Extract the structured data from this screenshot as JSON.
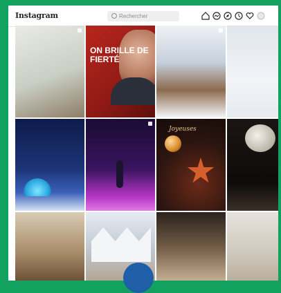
{
  "header": {
    "logo_text": "Instagram",
    "search_placeholder": "Rechercher",
    "icons": [
      "home-icon",
      "messages-icon",
      "explore-icon",
      "activity-icon",
      "heart-icon",
      "profile-icon"
    ]
  },
  "grid": {
    "tiles": [
      {
        "name": "post-reindeer-decor"
      },
      {
        "name": "post-on-brille-de-fierte",
        "text": "ON BRILLE DE FIERTÉ"
      },
      {
        "name": "post-winter-village"
      },
      {
        "name": "post-snowy-light"
      },
      {
        "name": "post-igloo-night"
      },
      {
        "name": "post-dancer-stage"
      },
      {
        "name": "post-christmas-starfish",
        "text": "Joyeuses"
      },
      {
        "name": "post-moon-ornament"
      },
      {
        "name": "post-shop-interior"
      },
      {
        "name": "post-snow-houses"
      },
      {
        "name": "post-lamp-room"
      },
      {
        "name": "post-white-decor"
      }
    ]
  },
  "colors": {
    "frame_green": "#12a15e",
    "topbar_bg": "#ffffff",
    "fab_blue": "#1f5fa8"
  }
}
